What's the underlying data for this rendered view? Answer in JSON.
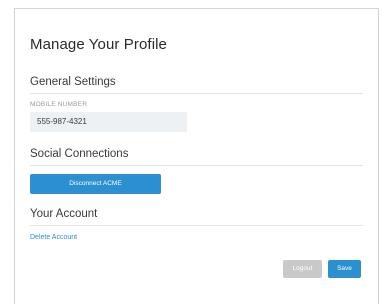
{
  "page": {
    "title": "Manage Your Profile"
  },
  "general_settings": {
    "heading": "General Settings",
    "mobile_label": "MOBILE NUMBER",
    "mobile_value": "555-987-4321"
  },
  "social_connections": {
    "heading": "Social Connections",
    "disconnect_label": "Disconnect ACME"
  },
  "account": {
    "heading": "Your Account",
    "delete_label": "Delete Account"
  },
  "actions": {
    "logout_label": "Logout",
    "save_label": "Save"
  },
  "colors": {
    "accent": "#2b8fd0",
    "disabled": "#c9c9c9",
    "input_bg": "#eef1f3"
  }
}
